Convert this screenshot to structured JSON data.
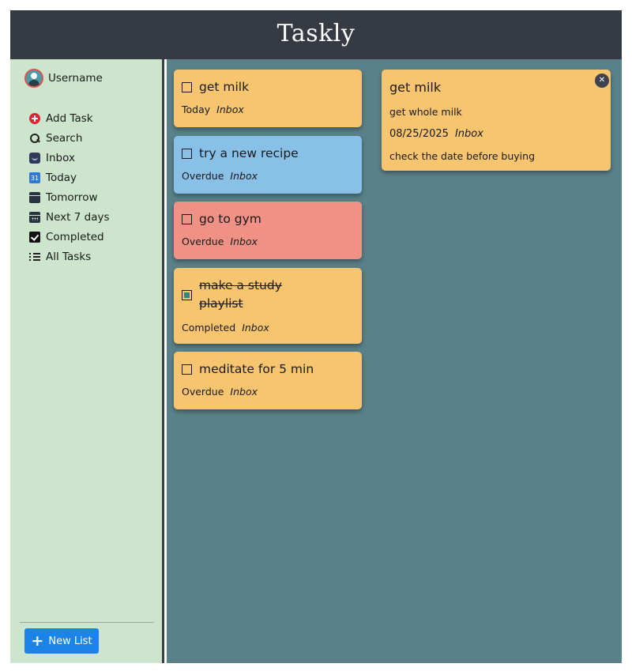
{
  "app": {
    "title": "Taskly"
  },
  "user": {
    "name": "Username"
  },
  "nav": [
    {
      "label": "Add Task",
      "icon": "add-task-icon"
    },
    {
      "label": "Search",
      "icon": "search-icon"
    },
    {
      "label": "Inbox",
      "icon": "inbox-icon"
    },
    {
      "label": "Today",
      "icon": "today-calendar-icon",
      "badge": "31"
    },
    {
      "label": "Tomorrow",
      "icon": "tomorrow-calendar-icon"
    },
    {
      "label": "Next 7 days",
      "icon": "week-calendar-icon"
    },
    {
      "label": "Completed",
      "icon": "completed-check-icon"
    },
    {
      "label": "All Tasks",
      "icon": "all-tasks-list-icon"
    }
  ],
  "sidebar_footer": {
    "new_list_label": "New List"
  },
  "tasks": [
    {
      "title": "get milk",
      "status": "Today",
      "list": "Inbox",
      "color": "#f7c46f",
      "completed": false
    },
    {
      "title": "try a new recipe",
      "status": "Overdue",
      "list": "Inbox",
      "color": "#88c0e8",
      "completed": false
    },
    {
      "title": "go to gym",
      "status": "Overdue",
      "list": "Inbox",
      "color": "#f09186",
      "completed": false
    },
    {
      "title": "make a study playlist",
      "status": "Completed",
      "list": "Inbox",
      "color": "#f7c46f",
      "completed": true
    },
    {
      "title": "meditate for 5 min",
      "status": "Overdue",
      "list": "Inbox",
      "color": "#f7c46f",
      "completed": false
    }
  ],
  "detail": {
    "title": "get milk",
    "description": "get whole milk",
    "date": "08/25/2025",
    "list": "Inbox",
    "notes": "check the date before buying",
    "close_symbol": "✕"
  },
  "colors": {
    "header_bg": "#353a43",
    "sidebar_bg": "#cce5cc",
    "main_bg": "#5a8189",
    "accent_button": "#1c84e6"
  }
}
